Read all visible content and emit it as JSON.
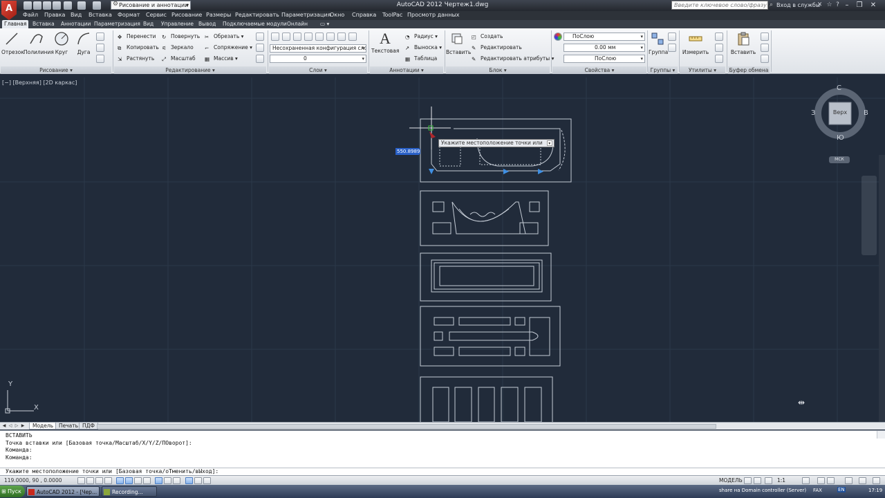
{
  "app": {
    "title": "AutoCAD 2012   Чертеж1.dwg",
    "logo_letter": "A",
    "workspace": "Рисование и аннотации",
    "search_placeholder": "Введите ключевое слово/фразу",
    "sign_in": "Вход в службы",
    "accent_color": "#c8281c"
  },
  "menu": [
    "Файл",
    "Правка",
    "Вид",
    "Вставка",
    "Формат",
    "Сервис",
    "Рисование",
    "Размеры",
    "Редактировать",
    "Параметризация",
    "Окно",
    "Справка",
    "ToolPac",
    "Просмотр данных"
  ],
  "ribbon_tabs": [
    "Главная",
    "Вставка",
    "Аннотации",
    "Параметризация",
    "Вид",
    "Управление",
    "Вывод",
    "Подключаемые модули",
    "Онлайн"
  ],
  "ribbon": {
    "draw": {
      "title": "Рисование",
      "tools": [
        "Отрезок",
        "Полилиния",
        "Круг",
        "Дуга"
      ]
    },
    "modify": {
      "title": "Редактирование",
      "tools": [
        "Перенести",
        "Повернуть",
        "Обрезать",
        "Копировать",
        "Зеркало",
        "Сопряжение",
        "Растянуть",
        "Масштаб",
        "Массив"
      ]
    },
    "layers": {
      "title": "Слои",
      "layer_state": "Несохраненная конфигурация слоев",
      "current_layer": "0"
    },
    "annotation": {
      "title": "Аннотации",
      "text_tool": "Текстовая",
      "tools": [
        "Радиус",
        "Выноска",
        "Таблица"
      ]
    },
    "block": {
      "title": "Блок",
      "insert": "Вставить",
      "tools": [
        "Создать",
        "Редактировать",
        "Редактировать атрибуты"
      ]
    },
    "properties": {
      "title": "Свойства",
      "color": "ПоСлою",
      "lineweight": "0.00 мм",
      "linetype": "ПоСлою"
    },
    "groups": {
      "title": "Группы",
      "tool": "Группа"
    },
    "utilities": {
      "title": "Утилиты",
      "tool": "Измерить"
    },
    "clipboard": {
      "title": "Буфер обмена",
      "tool": "Вставить"
    }
  },
  "viewport": {
    "label": "[−] [Верхняя] [2D каркас]",
    "viewcube": {
      "top": "Верх",
      "n": "С",
      "s": "Ю",
      "w": "З",
      "e": "В",
      "wcs": "МСК"
    },
    "ucs_y": "Y",
    "ucs_x": "X",
    "tooltip": "Укажите местоположение точки или",
    "dynamic_input": "550.8989"
  },
  "layout_tabs": [
    "Модель",
    "Печать",
    "ПДФ"
  ],
  "command": {
    "history": [
      "ВСТАВИТЬ",
      "Точка вставки или [Базовая точка/Масштаб/X/Y/Z/ПОворот]:",
      "Команда:",
      "Команда:"
    ],
    "prompt": "Укажите местоположение точки или [Базовая точка/оТменить/вЫход]:"
  },
  "status": {
    "coords": "119.0000, 90   , 0.0000",
    "model": "МОДЕЛЬ",
    "scale": "1:1"
  },
  "taskbar": {
    "start": "Пуск",
    "tasks": [
      "AutoCAD 2012 - [Чер...",
      "Recording..."
    ],
    "tray": "share на Domain controller (Server)",
    "fax": "FAX",
    "lang": "EN",
    "clock": "17:19"
  }
}
